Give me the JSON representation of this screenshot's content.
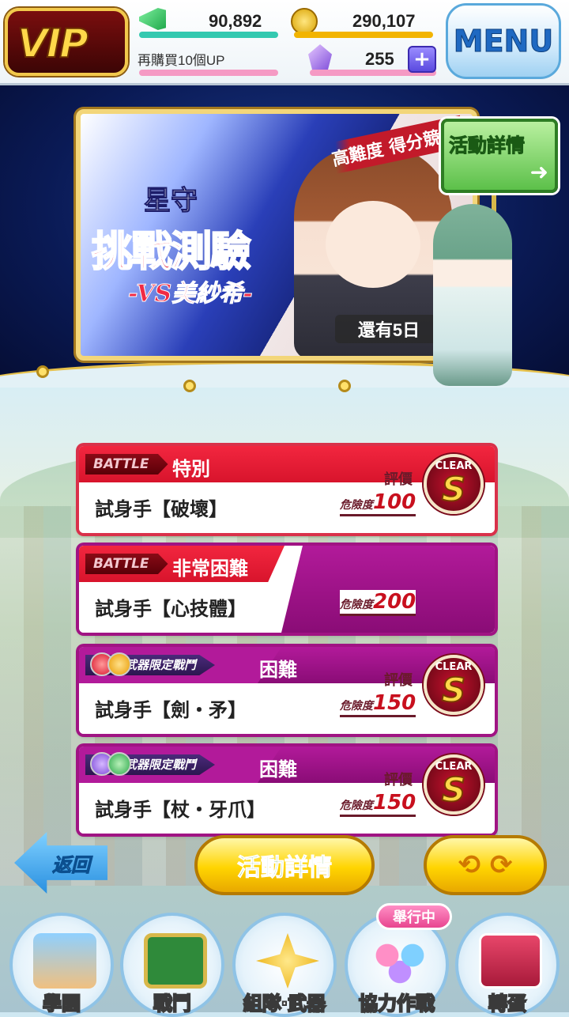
{
  "header": {
    "vip_label": "VIP",
    "promo_text": "再購買10個UP",
    "stamina_value": "90,892",
    "coin_value": "290,107",
    "gem_value": "255",
    "add_symbol": "+",
    "menu_label": "MENU"
  },
  "event_banner": {
    "title_top": "星守",
    "title_main": "挑戰測驗",
    "title_vs": "-VS美紗希-",
    "subtitle": "高難度 得分競賽",
    "days_left": "還有5日",
    "sign_label": "活動詳情",
    "sign_arrow": "➜"
  },
  "battles": [
    {
      "tag": "BATTLE",
      "difficulty": "特別",
      "name": "試身手【破壞】",
      "danger_label": "危險度",
      "danger_value": "100",
      "eval_label": "評價",
      "clear_label": "CLEAR",
      "rank": "S"
    },
    {
      "tag": "BATTLE",
      "difficulty": "非常困難",
      "name": "試身手【心技體】",
      "danger_label": "危險度",
      "danger_value": "200"
    },
    {
      "tag": "武器限定戰鬥",
      "difficulty": "困難",
      "name": "試身手【劍・矛】",
      "danger_label": "危險度",
      "danger_value": "150",
      "eval_label": "評價",
      "clear_label": "CLEAR",
      "rank": "S"
    },
    {
      "tag": "武器限定戰鬥",
      "difficulty": "困難",
      "name": "試身手【杖・牙爪】",
      "danger_label": "危險度",
      "danger_value": "150",
      "eval_label": "評價",
      "clear_label": "CLEAR",
      "rank": "S"
    }
  ],
  "actions": {
    "back_label": "返回",
    "detail_label": "活動詳情",
    "refresh_symbol": "⟲ ⟳"
  },
  "nav": {
    "items": [
      "學園",
      "戰鬥",
      "組隊‧武器",
      "協力作戰",
      "轉蛋"
    ],
    "badge": "舉行中"
  },
  "colors": {
    "battle_red": "#d8142c",
    "battle_purple": "#a01483",
    "menu_blue": "#1f69c2",
    "gold": "#ffd400"
  }
}
